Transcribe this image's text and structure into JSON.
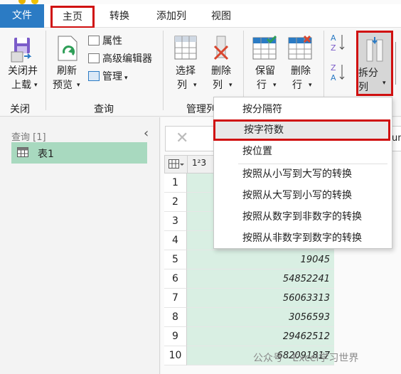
{
  "tabs": [
    {
      "label": "文件"
    },
    {
      "label": "主页"
    },
    {
      "label": "转换"
    },
    {
      "label": "添加列"
    },
    {
      "label": "视图"
    }
  ],
  "ribbon": {
    "close_load": {
      "line1": "关闭并",
      "line2": "上载"
    },
    "refresh": {
      "line1": "刷新",
      "line2": "预览"
    },
    "properties": "属性",
    "advanced_editor": "高级编辑器",
    "manage": "管理",
    "choose_cols": {
      "line1": "选择",
      "line2": "列"
    },
    "remove_cols": {
      "line1": "删除",
      "line2": "列"
    },
    "keep_rows": {
      "line1": "保留",
      "line2": "行"
    },
    "remove_rows": {
      "line1": "删除",
      "line2": "行"
    },
    "split_col": {
      "line1": "拆分",
      "line2": "列"
    },
    "groups": {
      "close": "关闭",
      "query": "查询",
      "manage_cols": "管理列"
    }
  },
  "left_panel": {
    "queries_label": "查询 [1]",
    "query_name": "表1"
  },
  "formula": {
    "partial_text": "um"
  },
  "grid": {
    "col_type": "1²3",
    "row_numbers": [
      1,
      2,
      3,
      4,
      5,
      6,
      7,
      8,
      9,
      10
    ],
    "values": [
      "",
      "",
      "",
      "",
      "19045",
      "54852241",
      "56063313",
      "3056593",
      "29462512",
      "682091817"
    ]
  },
  "split_menu": {
    "items": [
      "按分隔符",
      "按字符数",
      "按位置",
      "按照从小写到大写的转换",
      "按照从大写到小写的转换",
      "按照从数字到非数字的转换",
      "按照从非数字到数字的转换"
    ],
    "highlighted_index": 1
  },
  "watermark": "公众号 · Excel学习世界",
  "colors": {
    "accent": "#2b7bc4",
    "highlight": "#d01010",
    "selected_query": "#a8d9bf",
    "column_fill": "#d9efe3"
  }
}
